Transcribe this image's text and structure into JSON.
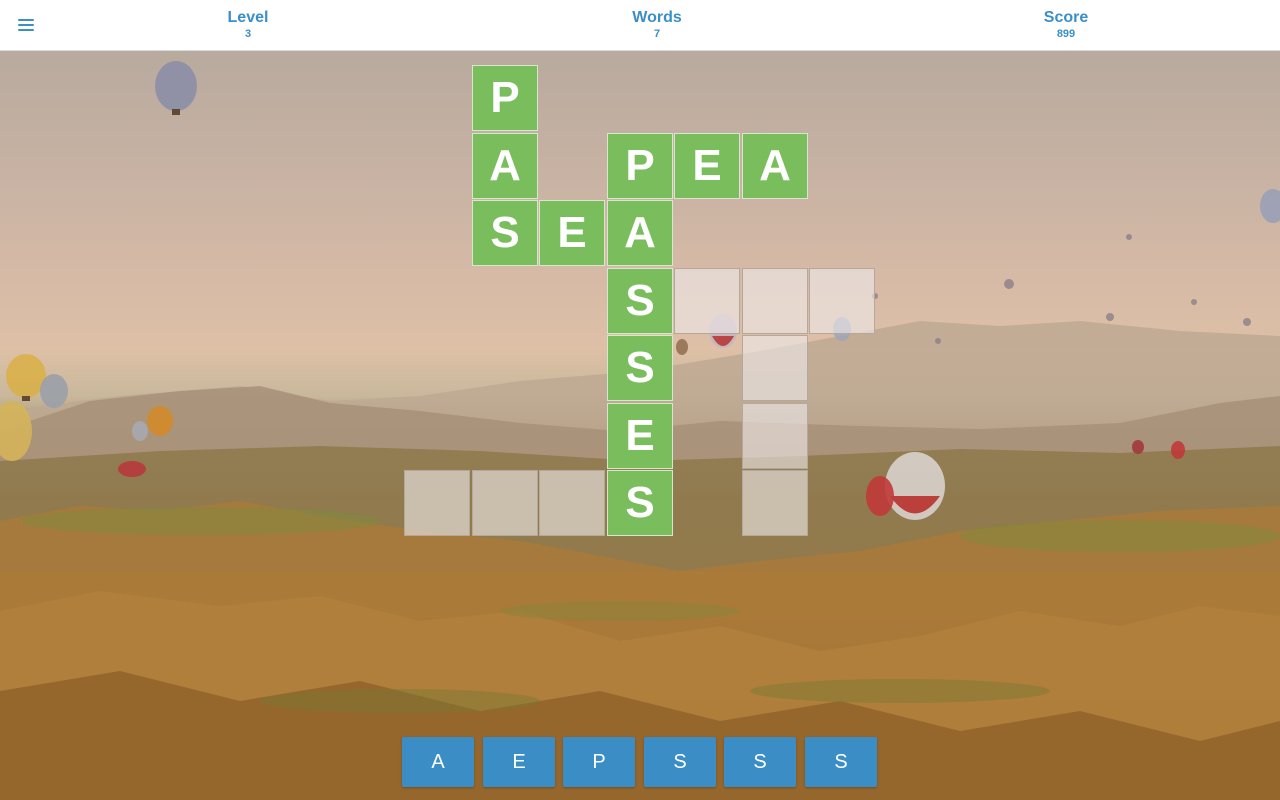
{
  "header": {
    "level_label": "Level",
    "level_value": "3",
    "words_label": "Words",
    "words_value": "7",
    "score_label": "Score",
    "score_value": "899",
    "menu_icon": "hamburger-menu-icon"
  },
  "colors": {
    "accent": "#3a8fc9",
    "tile_filled": "#79bd5c",
    "tile_empty": "rgba(238,232,232,0.62)",
    "letter_button": "#3b8ec5"
  },
  "grid": {
    "filled": [
      {
        "row": 0,
        "col": 1,
        "letter": "P"
      },
      {
        "row": 1,
        "col": 1,
        "letter": "A"
      },
      {
        "row": 1,
        "col": 3,
        "letter": "P"
      },
      {
        "row": 1,
        "col": 4,
        "letter": "E"
      },
      {
        "row": 1,
        "col": 5,
        "letter": "A"
      },
      {
        "row": 2,
        "col": 1,
        "letter": "S"
      },
      {
        "row": 2,
        "col": 2,
        "letter": "E"
      },
      {
        "row": 2,
        "col": 3,
        "letter": "A"
      },
      {
        "row": 3,
        "col": 3,
        "letter": "S"
      },
      {
        "row": 4,
        "col": 3,
        "letter": "S"
      },
      {
        "row": 5,
        "col": 3,
        "letter": "E"
      },
      {
        "row": 6,
        "col": 3,
        "letter": "S"
      }
    ],
    "empty": [
      {
        "row": 3,
        "col": 4
      },
      {
        "row": 3,
        "col": 5
      },
      {
        "row": 3,
        "col": 6
      },
      {
        "row": 4,
        "col": 5
      },
      {
        "row": 5,
        "col": 5
      },
      {
        "row": 6,
        "col": 0
      },
      {
        "row": 6,
        "col": 1
      },
      {
        "row": 6,
        "col": 2
      },
      {
        "row": 6,
        "col": 5
      }
    ]
  },
  "letters": [
    "A",
    "E",
    "P",
    "S",
    "S",
    "S"
  ]
}
